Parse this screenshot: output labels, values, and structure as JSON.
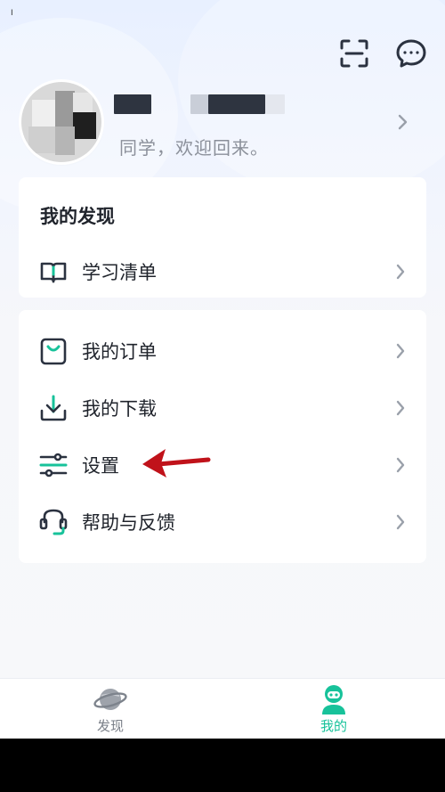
{
  "status": {
    "mark": "I"
  },
  "header": {
    "scan_icon": "scan-icon",
    "message_icon": "message-icon"
  },
  "profile": {
    "greeting": "同学，欢迎回来。",
    "chevron": "chevron-right-icon"
  },
  "discover_card": {
    "title": "我的发现",
    "items": [
      {
        "label": "学习清单",
        "icon": "book-icon"
      }
    ]
  },
  "menu_card": {
    "items": [
      {
        "label": "我的订单",
        "icon": "order-bag-icon"
      },
      {
        "label": "我的下载",
        "icon": "download-icon"
      },
      {
        "label": "设置",
        "icon": "settings-sliders-icon"
      },
      {
        "label": "帮助与反馈",
        "icon": "headset-icon"
      }
    ]
  },
  "tabbar": {
    "tabs": [
      {
        "label": "发现",
        "icon": "planet-icon",
        "active": false
      },
      {
        "label": "我的",
        "icon": "user-face-icon",
        "active": true
      }
    ]
  },
  "colors": {
    "accent": "#17c29a",
    "text_primary": "#20242c",
    "text_secondary": "#8b909a",
    "annotation_arrow": "#c0121a"
  }
}
